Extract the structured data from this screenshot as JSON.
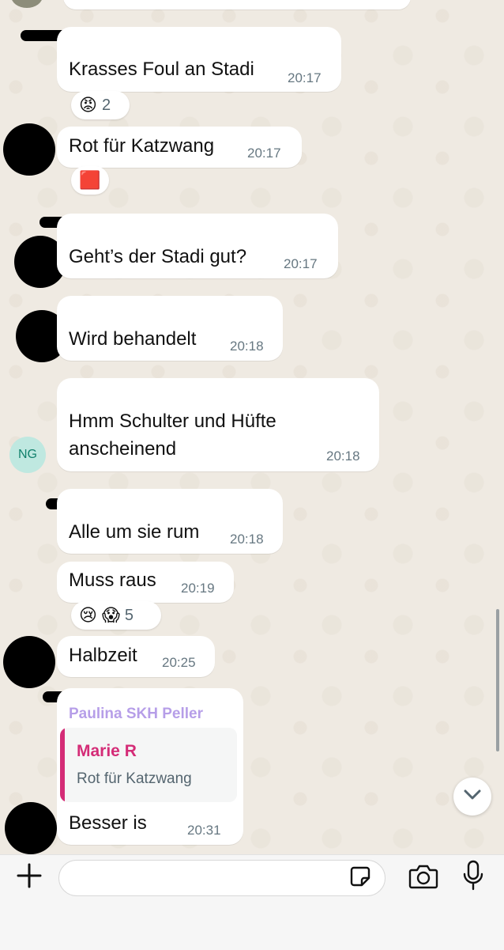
{
  "messages": [
    {
      "text": "Krasses Foul an Stadi",
      "time": "20:17"
    },
    {
      "text": "Rot für Katzwang",
      "time": "20:17"
    },
    {
      "text": "Geht’s der Stadi gut?",
      "time": "20:17"
    },
    {
      "text": "Wird behandelt",
      "time": "20:18"
    },
    {
      "text_line1": "Hmm Schulter und Hüfte",
      "text_line2": "anscheinend",
      "time": "20:18",
      "avatar_initials": "NG"
    },
    {
      "text": "Alle um sie rum",
      "time": "20:18"
    },
    {
      "text": "Muss raus",
      "time": "20:19"
    },
    {
      "text": "Halbzeit",
      "time": "20:25"
    },
    {
      "reply_sender": "Paulina SKH Peller",
      "quoted_sender": "Marie R",
      "quoted_text": "Rot für Katzwang",
      "text": "Besser is",
      "time": "20:31"
    }
  ],
  "reactions": {
    "r1": {
      "emoji": "😡",
      "count": "2"
    },
    "r2": {
      "emoji": "🟥"
    },
    "r3": {
      "emoji1": "😢",
      "emoji2": "😱",
      "count": "5"
    }
  },
  "colors": {
    "bg": "#efeae2",
    "bubble": "#ffffff",
    "time": "#667781",
    "quote_accent": "#d42c77",
    "reply_sender": "#7b4fd6",
    "ng_avatar_bg": "#bfe8e0"
  },
  "icons": {
    "plus": "plus-icon",
    "sticker": "sticker-icon",
    "camera": "camera-icon",
    "mic": "microphone-icon",
    "scroll_down": "chevron-down-icon"
  }
}
